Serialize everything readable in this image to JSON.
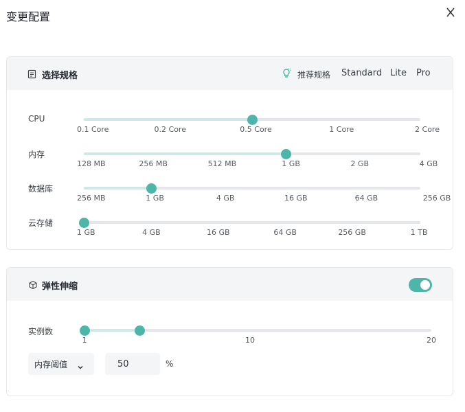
{
  "dialog": {
    "title": "变更配置",
    "close_icon": "close-icon"
  },
  "spec": {
    "title": "选择规格",
    "icon": "list-icon",
    "recommend_label": "推荐规格",
    "recommend_icon": "lightbulb-icon",
    "presets": [
      "Standard",
      "Lite",
      "Pro"
    ],
    "accent": "#4db6a8",
    "rows": [
      {
        "label": "CPU",
        "ticks": [
          "0.1 Core",
          "0.2 Core",
          "0.5 Core",
          "1 Core",
          "2 Core"
        ],
        "selected_index": 2
      },
      {
        "label": "内存",
        "ticks": [
          "128 MB",
          "256 MB",
          "512 MB",
          "1 GB",
          "2 GB",
          "4 GB"
        ],
        "selected_index": 3
      },
      {
        "label": "数据库",
        "ticks": [
          "256 MB",
          "1 GB",
          "4 GB",
          "16 GB",
          "64 GB",
          "256 GB"
        ],
        "selected_index": 1
      },
      {
        "label": "云存储",
        "ticks": [
          "1 GB",
          "4 GB",
          "16 GB",
          "64 GB",
          "256 GB",
          "1 TB"
        ],
        "selected_index": 0
      }
    ]
  },
  "autoscale": {
    "title": "弹性伸缩",
    "icon": "cube-icon",
    "enabled": true,
    "instances": {
      "label": "实例数",
      "ticks": [
        "1",
        "10",
        "20"
      ],
      "min": 1,
      "max": 20,
      "range": [
        1,
        4
      ]
    },
    "metric": {
      "selected": "内存阈值",
      "value": "50",
      "unit": "%"
    }
  }
}
